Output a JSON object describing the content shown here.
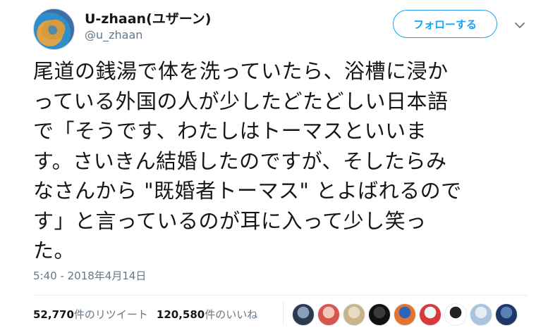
{
  "user": {
    "display_name": "U-zhaan(ユザーン)",
    "handle": "@u_zhaan"
  },
  "follow_button_label": "フォローする",
  "icons": {
    "more": "chevron-down-icon",
    "avatar": "user-avatar"
  },
  "tweet": {
    "lines": [
      "尾道の銭湯で体を洗っていたら、浴槽に浸か",
      "っている外国の人が少したどたどしい日本語",
      "で「そうです、わたしはトーマスといいま",
      "す。さいきん結婚したのですが、そしたらみ",
      "なさんから \"既婚者トーマス\" とよばれるので",
      "す」と言っているのが耳に入って少し笑っ",
      "た。"
    ],
    "timestamp": "5:40 - 2018年4月14日"
  },
  "stats": {
    "retweets_count": "52,770",
    "retweets_label": "件のリツイート",
    "likes_count": "120,580",
    "likes_label": "件のいいね"
  },
  "likers": [
    {
      "colors": [
        "#2b3a4f",
        "#8aa0b8"
      ]
    },
    {
      "colors": [
        "#d9534f",
        "#f2c7b8"
      ]
    },
    {
      "colors": [
        "#c9b48a",
        "#e8dcc3"
      ]
    },
    {
      "colors": [
        "#111111",
        "#3b3b3b"
      ]
    },
    {
      "colors": [
        "#e2742f",
        "#2b64b8"
      ]
    },
    {
      "colors": [
        "#d83a3a",
        "#f4f4f4"
      ]
    },
    {
      "colors": [
        "#ffffff",
        "#222222"
      ]
    },
    {
      "colors": [
        "#a9c4dc",
        "#e5edf4"
      ]
    },
    {
      "colors": [
        "#1d3766",
        "#5a7fb8"
      ]
    }
  ],
  "colors": {
    "accent": "#1da1f2",
    "text": "#14171a",
    "muted": "#657786",
    "border": "#e6ecf0"
  }
}
